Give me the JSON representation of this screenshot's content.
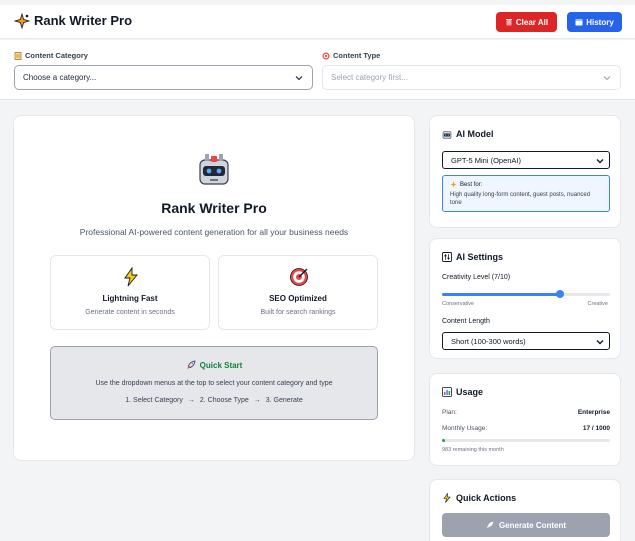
{
  "header": {
    "app_title": "Rank Writer Pro",
    "clear_all_label": "Clear All",
    "history_label": "History"
  },
  "selectors": {
    "category_label": "Content Category",
    "category_value": "Choose a category...",
    "type_label": "Content Type",
    "type_value": "Select category first..."
  },
  "main": {
    "title": "Rank Writer Pro",
    "subtitle": "Professional AI-powered content generation for all your business needs",
    "features": [
      {
        "title": "Lightning Fast",
        "desc": "Generate content in seconds"
      },
      {
        "title": "SEO Optimized",
        "desc": "Built for search rankings"
      }
    ],
    "quickstart": {
      "title": "Quick Start",
      "desc": "Use the dropdown menus at the top to select your content category and type",
      "steps": [
        "1. Select Category",
        "2. Choose Type",
        "3. Generate"
      ],
      "arrow": "→"
    }
  },
  "ai_model": {
    "title": "AI Model",
    "selected": "GPT-5 Mini (OpenAI)",
    "best_for_label": "Best for:",
    "best_for_text": "High quality long-form content, guest posts, nuanced tone"
  },
  "ai_settings": {
    "title": "AI Settings",
    "creativity_label": "Creativity Level (7/10)",
    "creativity_value": 7,
    "creativity_max": 10,
    "min_label": "Conservative",
    "max_label": "Creative",
    "length_label": "Content Length",
    "length_value": "Short (100-300 words)"
  },
  "usage": {
    "title": "Usage",
    "plan_label": "Plan:",
    "plan_value": "Enterprise",
    "monthly_label": "Monthly Usage:",
    "monthly_value": "17 / 1000",
    "used": 17,
    "limit": 1000,
    "remaining_text": "983 remaining this month"
  },
  "quick_actions": {
    "title": "Quick Actions",
    "generate_label": "Generate Content"
  },
  "colors": {
    "clear_all": "#dc2626",
    "history": "#2563eb",
    "slider": "#3b82f6",
    "usage_bar": "#16a34a",
    "quickstart_title": "#15803d",
    "generate_disabled": "#9ca3af"
  },
  "icons": {
    "logo": "sparkle-icon",
    "trash": "trash-icon",
    "history": "calendar-icon",
    "category": "memo-icon",
    "type": "target-icon",
    "robot": "robot-icon",
    "lightning": "lightning-icon",
    "seo": "target-icon",
    "rocket": "rocket-icon",
    "model": "robot-icon",
    "settings": "control-panel-icon",
    "usage": "bar-chart-icon",
    "actions": "lightning-icon"
  }
}
